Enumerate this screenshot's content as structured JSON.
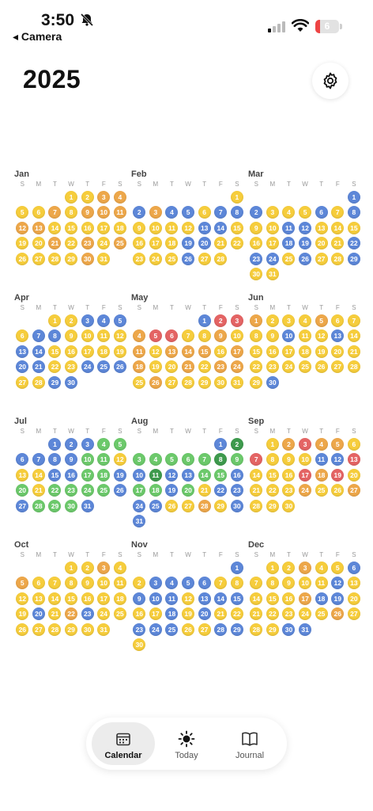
{
  "status_bar": {
    "time": "3:50",
    "back_label": "◂ Camera",
    "battery": "6"
  },
  "header": {
    "year": "2025"
  },
  "weekday_letters": [
    "S",
    "M",
    "T",
    "W",
    "T",
    "F",
    "S"
  ],
  "colors": {
    "y": "#f6cd3c",
    "o": "#eda74a",
    "b": "#5d87d8",
    "g": "#6cc96b",
    "r": "#e46464",
    "d": "#3e9a4d"
  },
  "months": [
    {
      "name": "Jan",
      "start": 3,
      "moods": "yyooyyoyoooooyyyyyyyoyoyoyyyyoy"
    },
    {
      "name": "Feb",
      "start": 6,
      "moods": "ybobbybbyyyybbyyyybbyyyyybyy"
    },
    {
      "name": "Mar",
      "start": 6,
      "moods": "bbyyybybyybbyyyyybbyybbbybyybyyy"
    },
    {
      "name": "Apr",
      "start": 2,
      "moods": "yybbbybbyyyybbyyyyybbyybbbyybb"
    },
    {
      "name": "May",
      "start": 4,
      "moods": "brrorryyoyoyoooyooyyoyooyoyyyyyy"
    },
    {
      "name": "Jun",
      "start": 0,
      "moods": "oyyyoyyyybyybyyyyyyyyyyyyyyyybb"
    },
    {
      "name": "Jul",
      "start": 2,
      "moods": "bbbggbbbbggyyybbggbgyggggbbgggbgb"
    },
    {
      "name": "Aug",
      "start": 5,
      "moods": "bdgggggdgbdbbggbggbgybbbbyyoybbbyyb"
    },
    {
      "name": "Sep",
      "start": 1,
      "moods": "yorooyryyybbryyyroryyyyoyyoyyyy"
    },
    {
      "name": "Oct",
      "start": 3,
      "moods": "yyoyoyyyyyyyyyyyyyybyobyyyyyyyyoyb"
    },
    {
      "name": "Nov",
      "start": 6,
      "moods": "bybbbbyybbbybbbyybybyybbbyybbybb"
    },
    {
      "name": "Dec",
      "start": 1,
      "moods": "yyoyybyyyyybyyyyobbyyyyyyoyyybby"
    }
  ],
  "tabs": [
    {
      "label": "Calendar",
      "icon": "calendar-icon",
      "active": true
    },
    {
      "label": "Today",
      "icon": "sun-icon",
      "active": false
    },
    {
      "label": "Journal",
      "icon": "book-icon",
      "active": false
    }
  ]
}
